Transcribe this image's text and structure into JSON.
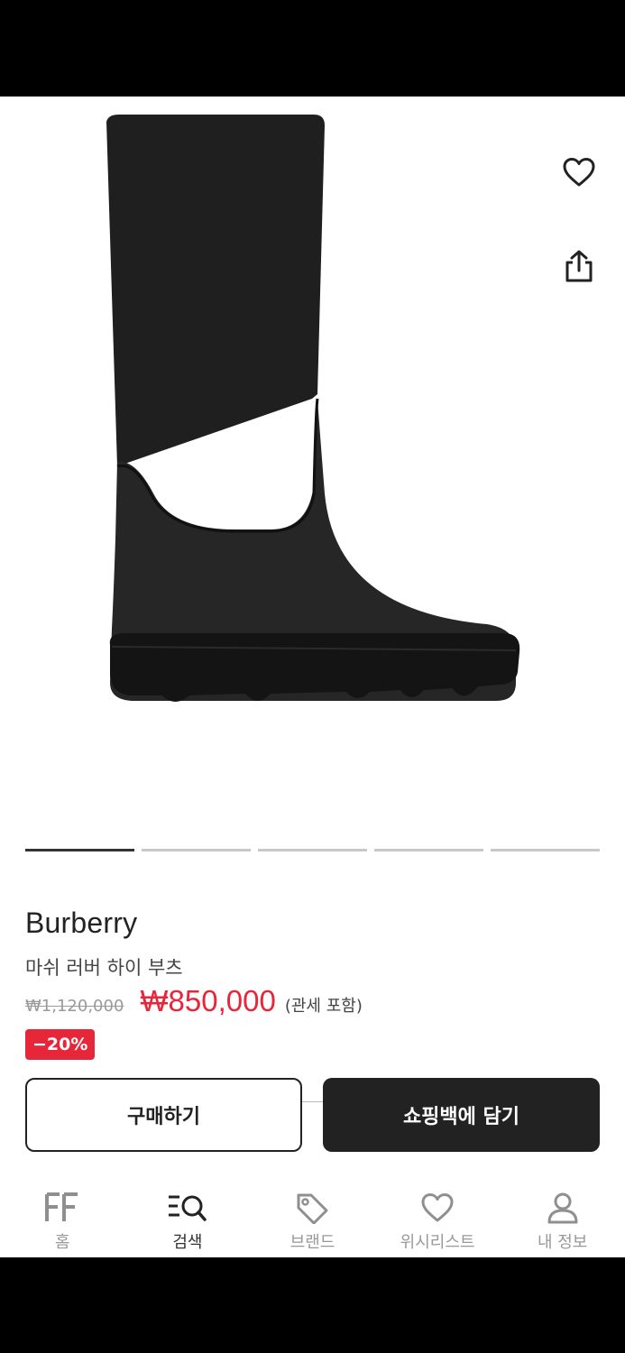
{
  "product": {
    "brand": "Burberry",
    "name": "마쉬 러버 하이 부츠",
    "original_price": "₩1,120,000",
    "sale_price": "₩850,000",
    "tax_note": "(관세 포함)",
    "discount": "−20%"
  },
  "gallery": {
    "total_images": 5,
    "active_index": 0
  },
  "icons": {
    "wishlist": "heart-icon",
    "share": "share-icon"
  },
  "actions": {
    "buy_label": "구매하기",
    "cart_label": "쇼핑백에 담기"
  },
  "nav": {
    "items": [
      {
        "label": "홈",
        "icon": "home-icon"
      },
      {
        "label": "검색",
        "icon": "search-icon"
      },
      {
        "label": "브랜드",
        "icon": "tag-icon"
      },
      {
        "label": "위시리스트",
        "icon": "heart-icon"
      },
      {
        "label": "내 정보",
        "icon": "user-icon"
      }
    ],
    "active_index": 1
  },
  "colors": {
    "sale": "#e8263a",
    "primary_button": "#222222",
    "indicator_active": "#333333",
    "indicator_inactive": "#c8c8c8"
  }
}
